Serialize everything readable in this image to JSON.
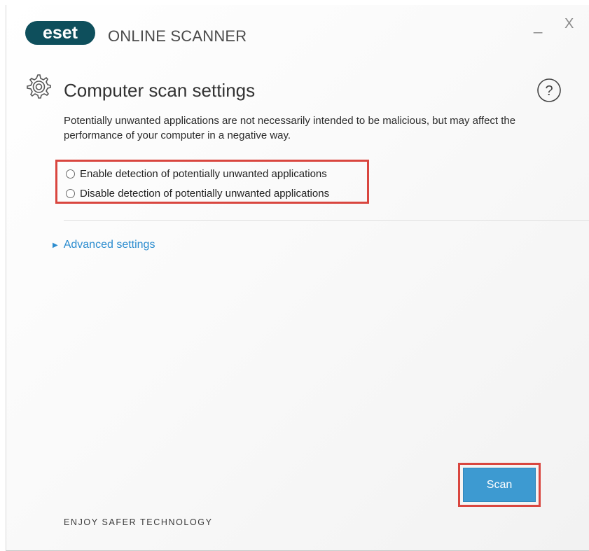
{
  "header": {
    "logo_text": "eset",
    "app_title": "ONLINE SCANNER",
    "minimize_glyph": "_",
    "close_glyph": "X"
  },
  "section": {
    "title": "Computer scan settings",
    "help_glyph": "?",
    "description": "Potentially unwanted applications are not necessarily intended to be malicious, but may affect the performance of your computer in a negative way."
  },
  "options": [
    {
      "label": "Enable detection of potentially unwanted applications",
      "selected": false
    },
    {
      "label": "Disable detection of potentially unwanted applications",
      "selected": false
    }
  ],
  "advanced": {
    "label": "Advanced settings"
  },
  "scan_button": {
    "label": "Scan"
  },
  "footer": {
    "tagline": "ENJOY SAFER TECHNOLOGY"
  },
  "colors": {
    "accent_blue": "#3d9ad1",
    "link_blue": "#2b8ccf",
    "highlight_red": "#d9463f",
    "logo_teal": "#0e4f5c"
  },
  "icons": [
    "eset-logo",
    "minimize-icon",
    "close-icon",
    "gear-icon",
    "help-icon",
    "expand-arrow-icon",
    "radio-icon"
  ]
}
